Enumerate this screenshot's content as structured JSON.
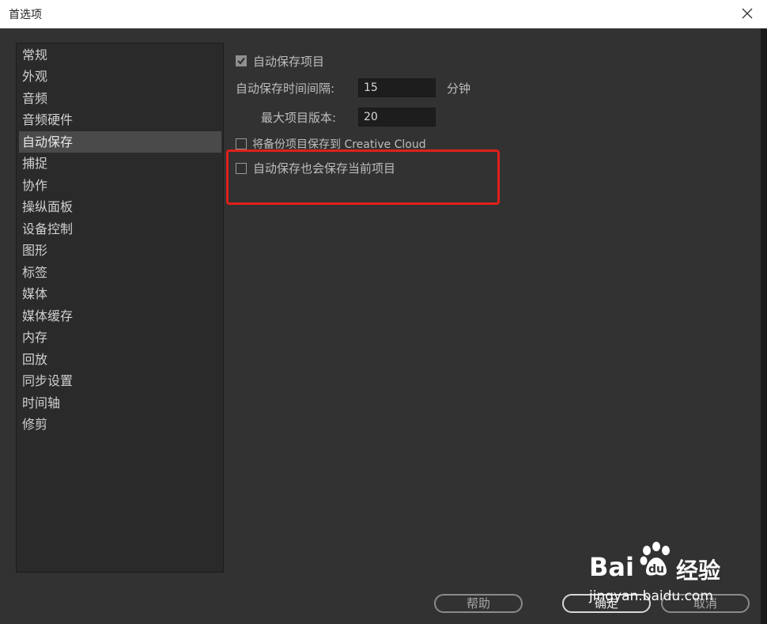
{
  "window": {
    "title": "首选项"
  },
  "sidebar": {
    "items": [
      {
        "label": "常规"
      },
      {
        "label": "外观"
      },
      {
        "label": "音频"
      },
      {
        "label": "音频硬件"
      },
      {
        "label": "自动保存",
        "selected": true
      },
      {
        "label": "捕捉"
      },
      {
        "label": "协作"
      },
      {
        "label": "操纵面板"
      },
      {
        "label": "设备控制"
      },
      {
        "label": "图形"
      },
      {
        "label": "标签"
      },
      {
        "label": "媒体"
      },
      {
        "label": "媒体缓存"
      },
      {
        "label": "内存"
      },
      {
        "label": "回放"
      },
      {
        "label": "同步设置"
      },
      {
        "label": "时间轴"
      },
      {
        "label": "修剪"
      }
    ]
  },
  "autosave": {
    "enable_label": "自动保存项目",
    "enable_checked": true,
    "interval_label": "自动保存时间间隔:",
    "interval_value": "15",
    "interval_unit": "分钟",
    "max_versions_label": "最大项目版本:",
    "max_versions_value": "20",
    "cloud_backup_label": "将备份项目保存到 Creative Cloud",
    "cloud_backup_checked": false,
    "save_current_label": "自动保存也会保存当前项目",
    "save_current_checked": false
  },
  "buttons": {
    "help": "帮助",
    "ok": "确定",
    "cancel": "取消"
  },
  "watermark": {
    "brand_latin": "Bai",
    "brand_cn": "经验",
    "url": "jingyan.baidu.com"
  },
  "colors": {
    "highlight": "#e0201a",
    "background": "#323232",
    "selected": "#4a4a4a"
  }
}
